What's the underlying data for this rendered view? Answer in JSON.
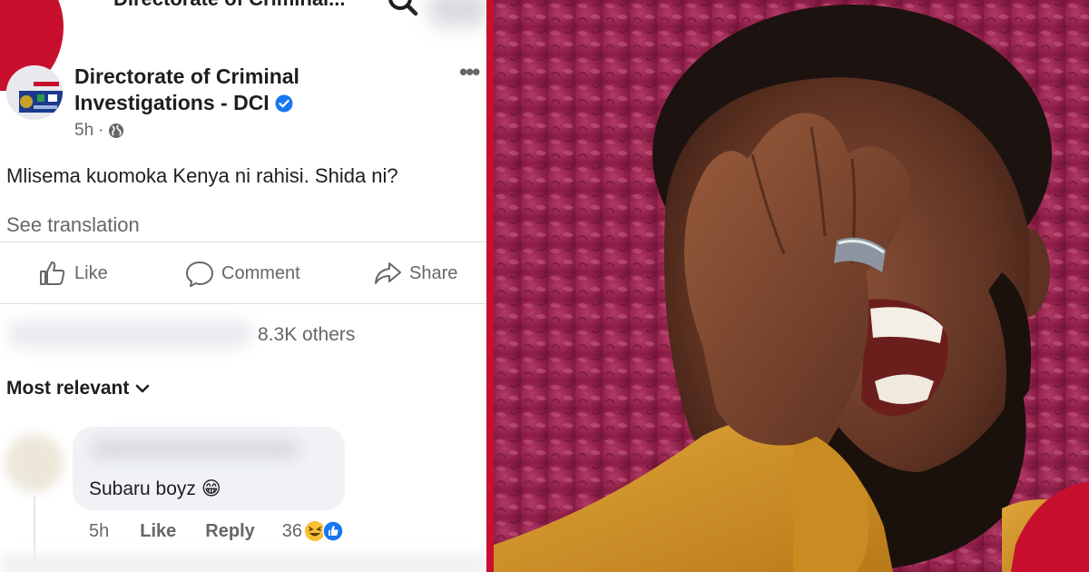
{
  "header": {
    "title": "Directorate of Criminal..."
  },
  "post": {
    "author": "Directorate of Criminal",
    "author_line2": "Investigations - DCI",
    "time": "5h",
    "text": "Mlisema kuomoka Kenya ni rahisi. Shida ni?",
    "see_translation": "See translation"
  },
  "actions": {
    "like": "Like",
    "comment": "Comment",
    "share": "Share"
  },
  "reactions": {
    "others": "8.3K others"
  },
  "comments": {
    "sort_label": "Most relevant",
    "items": [
      {
        "text": "Subaru boyz",
        "emoji": "😁",
        "time": "5h",
        "like": "Like",
        "reply": "Reply",
        "reaction_count": "36"
      }
    ]
  },
  "colors": {
    "brand_red": "#c8102e",
    "fb_blue": "#1877f2",
    "text": "#1c1e21",
    "muted": "#65676b"
  },
  "icons": [
    "search-icon",
    "verified-icon",
    "more-icon",
    "globe-icon",
    "like-icon",
    "comment-icon",
    "share-icon",
    "chevron-down-icon",
    "haha-reaction-icon",
    "like-reaction-icon"
  ]
}
